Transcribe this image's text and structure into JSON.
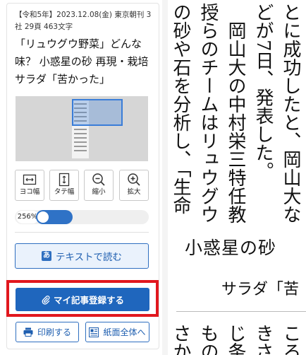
{
  "sidebar": {
    "meta": "【令和5年】2023.12.08(金) 東京朝刊 3社 29頁 463文字",
    "title": "「リュウグウ野菜」どんな味？ 小惑星の砂 再現・栽培 サラダ「苦かった」",
    "tools": [
      {
        "label": "ヨコ幅",
        "icon": "fit-width-icon"
      },
      {
        "label": "タテ幅",
        "icon": "fit-height-icon"
      },
      {
        "label": "縮小",
        "icon": "zoom-out-icon"
      },
      {
        "label": "拡大",
        "icon": "zoom-in-icon"
      }
    ],
    "zoom_level": "256%",
    "toggle_on": true,
    "text_button": "テキストで読む",
    "register_button": "マイ記事登録する",
    "print_button": "印刷する",
    "full_page_button": "紙面全体へ"
  },
  "article": {
    "columns": [
      "とに成功したと、岡山大な",
      "どが7日、発表した。",
      "　岡山大の中村栄三特任教",
      "授らのチームはリュウグウ",
      "の砂や石を分析し、「生命"
    ],
    "headline": "小惑星の砂",
    "subhead": "サラダ「苦",
    "lower_columns": [
      "ころ",
      "きさ",
      "じ条",
      "もの",
      "さか"
    ]
  },
  "colors": {
    "accent": "#1f66bd",
    "highlight": "#e1171e"
  }
}
